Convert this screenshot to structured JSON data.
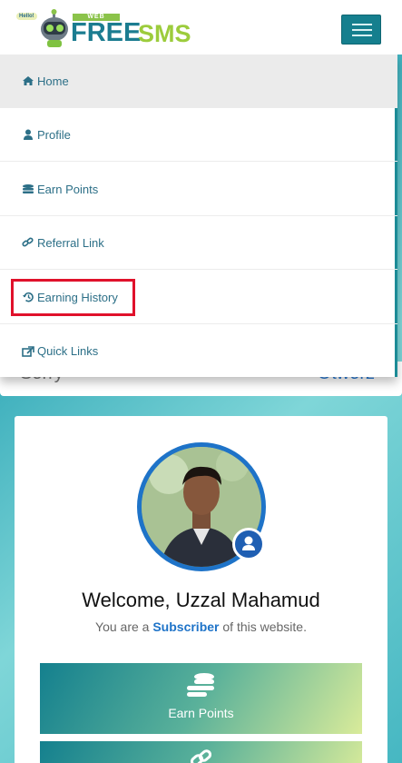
{
  "header": {
    "logo_hello": "Hello!",
    "logo_web": "WEB",
    "logo_free": "FREE",
    "logo_sms": "SMS"
  },
  "menu": {
    "items": [
      {
        "label": "Home",
        "icon": "home-icon"
      },
      {
        "label": "Profile",
        "icon": "user-icon"
      },
      {
        "label": "Earn Points",
        "icon": "coins-icon"
      },
      {
        "label": "Referral Link",
        "icon": "link-icon"
      },
      {
        "label": "Earning History",
        "icon": "history-icon"
      },
      {
        "label": "Quick Links",
        "icon": "external-link-icon"
      }
    ]
  },
  "behind_bar": {
    "left_text": "Sorry",
    "right_text": "Otwórz"
  },
  "profile": {
    "welcome": "Welcome, Uzzal Mahamud",
    "role_prefix": "You are a",
    "role": "Subscriber",
    "role_suffix": "of this website."
  },
  "tiles": {
    "earn_points": "Earn Points"
  },
  "colors": {
    "accent": "#157f8e",
    "link": "#1e73c8",
    "highlight": "#e0112b"
  }
}
